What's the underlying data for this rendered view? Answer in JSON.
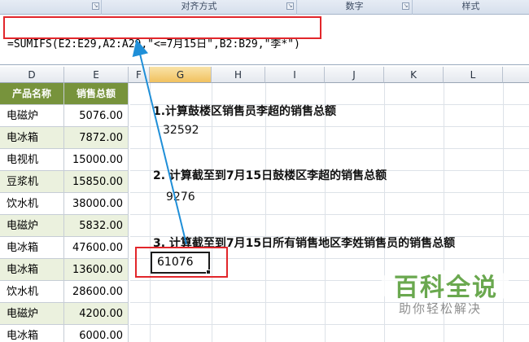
{
  "ribbon": {
    "groups": [
      "",
      "对齐方式",
      "数字",
      "样式"
    ]
  },
  "formula_bar": {
    "formula": "=SUMIFS(E2:E29,A2:A29,\"<=7月15日\",B2:B29,\"李*\")"
  },
  "columns": [
    "D",
    "E",
    "F",
    "G",
    "H",
    "I",
    "J",
    "K",
    "L"
  ],
  "selected_column": "G",
  "table": {
    "headers": [
      "产品名称",
      "销售总额"
    ],
    "rows": [
      {
        "product": "电磁炉",
        "amount": "5076.00"
      },
      {
        "product": "电冰箱",
        "amount": "7872.00"
      },
      {
        "product": "电视机",
        "amount": "15000.00"
      },
      {
        "product": "豆浆机",
        "amount": "15850.00"
      },
      {
        "product": "饮水机",
        "amount": "38000.00"
      },
      {
        "product": "电磁炉",
        "amount": "5832.00"
      },
      {
        "product": "电冰箱",
        "amount": "47600.00"
      },
      {
        "product": "电冰箱",
        "amount": "13600.00"
      },
      {
        "product": "饮水机",
        "amount": "28600.00"
      },
      {
        "product": "电磁炉",
        "amount": "4200.00"
      },
      {
        "product": "电冰箱",
        "amount": "6000.00"
      }
    ]
  },
  "questions": [
    {
      "label": "1.计算鼓楼区销售员李超的销售总额",
      "answer": "32592"
    },
    {
      "label": "2. 计算截至到7月15日鼓楼区李超的销售总额",
      "answer": "9276"
    },
    {
      "label": "3. 计算截至到7月15日所有销售地区李姓销售员的销售总额",
      "answer": "61076"
    }
  ],
  "colors": {
    "header_bg": "#77933c",
    "alt_row": "#ebf1de",
    "highlight": "#e2262b",
    "arrow": "#1f8fd8",
    "watermark": "#6aa84f"
  },
  "watermark": {
    "main": "百科全说",
    "sub": "助你轻松解决"
  }
}
